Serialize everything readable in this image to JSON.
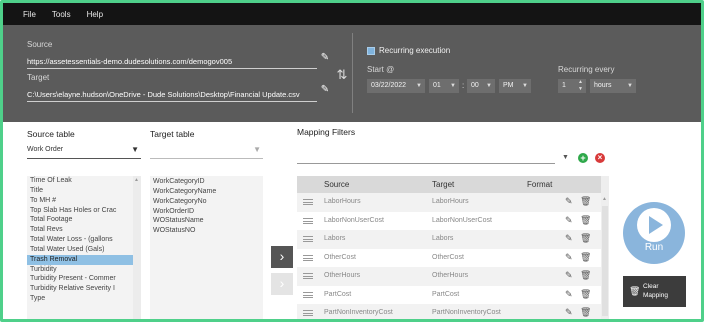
{
  "menu": [
    "File",
    "Tools",
    "Help"
  ],
  "source": {
    "label": "Source",
    "url": "https://assetessentials-demo.dudesolutions.com/demogov005"
  },
  "target": {
    "label": "Target",
    "path": "C:\\Users\\elayne.hudson\\OneDrive - Dude Solutions\\Desktop\\Financial Update.csv"
  },
  "schedule": {
    "recurring_label": "Recurring execution",
    "recurring_checked": true,
    "start_label": "Start @",
    "date": "03/22/2022",
    "hour": "01",
    "minute": "00",
    "ampm": "PM",
    "every_label": "Recurring every",
    "interval": "1",
    "unit": "hours"
  },
  "source_table": {
    "label": "Source table",
    "value": "Work Order",
    "fields": [
      "Time Of Leak",
      "Title",
      "To MH #",
      "Top Slab Has Holes or Crac",
      "Total Footage",
      "Total Revs",
      "Total Water Loss - (gallons",
      "Total Water Used (Gals)",
      "Trash Removal",
      "Turbidity",
      "Turbidity Present - Commer",
      "Turbidity Relative Severity I",
      "Type"
    ],
    "selected_index": 8
  },
  "target_table": {
    "label": "Target table",
    "value": "",
    "fields": [
      "WorkCategoryID",
      "WorkCategoryName",
      "WorkCategoryNo",
      "WorkOrderID",
      "WOStatusName",
      "WOStatusNO"
    ]
  },
  "mapping": {
    "filters_label": "Mapping Filters",
    "filter_value": "",
    "columns": [
      "Source",
      "Target",
      "Format"
    ],
    "rows": [
      {
        "source": "LaborHours",
        "target": "LaborHours"
      },
      {
        "source": "LaborNonUserCost",
        "target": "LaborNonUserCost"
      },
      {
        "source": "Labors",
        "target": "Labors"
      },
      {
        "source": "OtherCost",
        "target": "OtherCost"
      },
      {
        "source": "OtherHours",
        "target": "OtherHours"
      },
      {
        "source": "PartCost",
        "target": "PartCost"
      },
      {
        "source": "PartNonInventoryCost",
        "target": "PartNonInventoryCost"
      }
    ]
  },
  "actions": {
    "run": "Run",
    "clear_line1": "Clear",
    "clear_line2": "Mapping"
  },
  "colors": {
    "accent_border": "#4fd08a",
    "run_button": "#8ab5dc",
    "selection": "#8fc0e4",
    "add": "#2ea84a",
    "remove": "#d83a3a"
  }
}
